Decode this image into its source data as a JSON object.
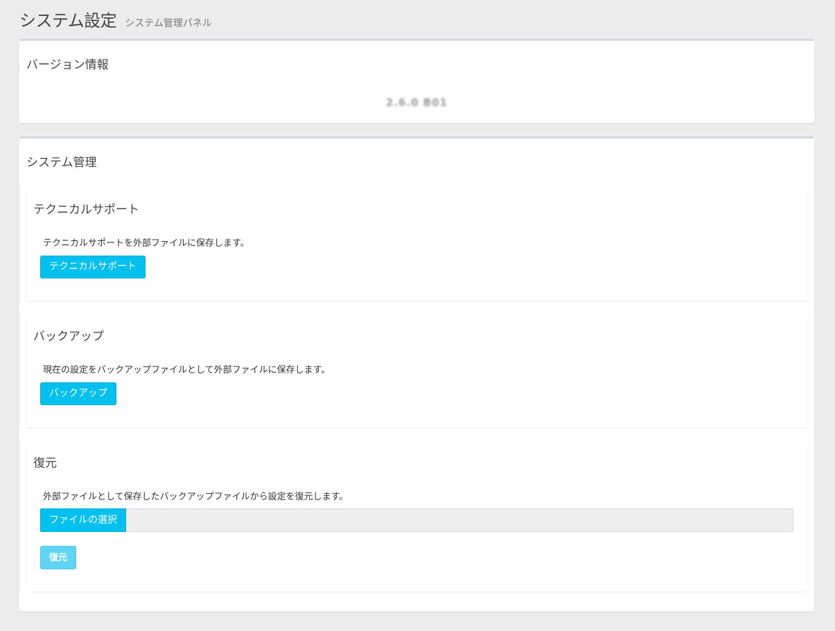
{
  "header": {
    "title": "システム設定",
    "subtitle": "システム管理パネル"
  },
  "version_box": {
    "title": "バージョン情報",
    "value": "2.6.0 B01"
  },
  "system_box": {
    "title": "システム管理",
    "tech_support": {
      "title": "テクニカルサポート",
      "description": "テクニカルサポートを外部ファイルに保存します。",
      "button_label": "テクニカルサポート"
    },
    "backup": {
      "title": "バックアップ",
      "description": "現在の設定をバックアップファイルとして外部ファイルに保存します。",
      "button_label": "バックアップ"
    },
    "restore": {
      "title": "復元",
      "description": "外部ファイルとして保存したバックアップファイルから設定を復元します。",
      "file_button_label": "ファイルの選択",
      "file_name": "",
      "button_label": "復元"
    }
  },
  "colors": {
    "page_background": "#ececec",
    "accent": "#00c0ef",
    "accent_disabled": "#5fd5f3",
    "box_border": "#d2d6de"
  }
}
